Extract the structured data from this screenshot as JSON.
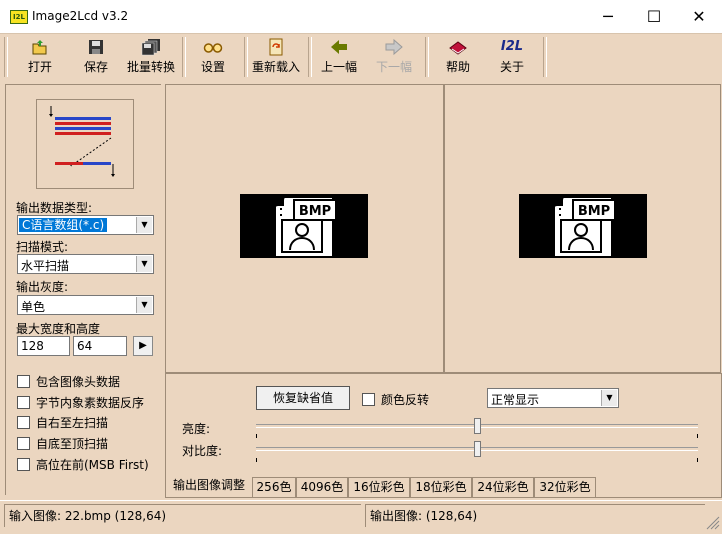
{
  "window": {
    "app_icon_text": "I2L",
    "title": "Image2Lcd v3.2",
    "minimize": "─",
    "maximize": "☐",
    "close": "✕"
  },
  "toolbar": {
    "open": "打开",
    "save": "保存",
    "batch": "批量转换",
    "settings": "设置",
    "reload": "重新载入",
    "prev": "上一幅",
    "next": "下一幅",
    "help": "帮助",
    "about": "关于",
    "about_icon_text": "I2L"
  },
  "left": {
    "output_type_label": "输出数据类型:",
    "output_type_value": "C语言数组(*.c)",
    "scan_mode_label": "扫描模式:",
    "scan_mode_value": "水平扫描",
    "gray_label": "输出灰度:",
    "gray_value": "单色",
    "maxsize_label": "最大宽度和高度",
    "width_value": "128",
    "height_value": "64",
    "checks": [
      "包含图像头数据",
      "字节内象素数据反序",
      "自右至左扫描",
      "自底至顶扫描",
      "高位在前(MSB First)"
    ]
  },
  "preview": {
    "badge_text": "BMP"
  },
  "controls": {
    "restore_default": "恢复缺省值",
    "invert_label": "颜色反转",
    "display_mode": "正常显示",
    "brightness_label": "亮度:",
    "contrast_label": "对比度:",
    "brightness_level": 0.5,
    "contrast_level": 0.5
  },
  "tabs": [
    "输出图像调整",
    "256色",
    "4096色",
    "16位彩色",
    "18位彩色",
    "24位彩色",
    "32位彩色"
  ],
  "status": {
    "input": "输入图像:  22.bmp (128,64)",
    "output": "输出图像:  (128,64)"
  },
  "colors": {
    "window_bg": "#ebd6c0",
    "selection": "#0078d7"
  }
}
